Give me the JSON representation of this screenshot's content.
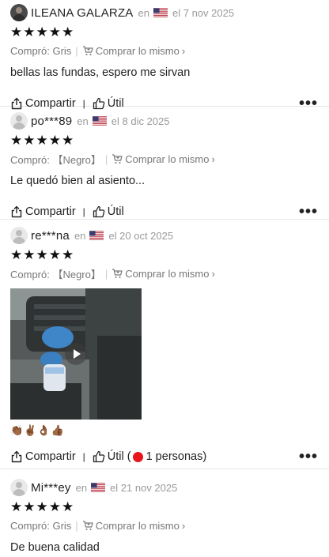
{
  "reviews": [
    {
      "name": "ILEANA GALARZA",
      "en": "en",
      "date": "el 7 nov 2025",
      "stars": "★★★★★",
      "variant": "Compró: Gris",
      "buy_same": "Comprar lo mismo",
      "text": "bellas las fundas, espero me sirvan",
      "share": "Compartir",
      "helpful": "Útil",
      "more": "•••"
    },
    {
      "name": "po***89",
      "en": "en",
      "date": "el 8 dic 2025",
      "stars": "★★★★★",
      "variant": "Compró: 【Negro】",
      "buy_same": "Comprar lo mismo",
      "text": "Le quedó bien al asiento...",
      "share": "Compartir",
      "helpful": "Útil",
      "more": "•••"
    },
    {
      "name": "re***na",
      "en": "en",
      "date": "el 20 oct 2025",
      "stars": "★★★★★",
      "variant": "Compró: 【Negro】",
      "buy_same": "Comprar lo mismo",
      "emojis": "👏🏾✌🏾👌🏾👍🏾",
      "share": "Compartir",
      "helpful": "Útil (",
      "helpful_count": "1 personas)",
      "more": "•••"
    },
    {
      "name": "Mi***ey",
      "en": "en",
      "date": "el 21 nov 2025",
      "stars": "★★★★★",
      "variant": "Compró: Gris",
      "buy_same": "Comprar lo mismo",
      "text": "De buena calidad"
    }
  ],
  "colors": {
    "accent_red": "#e8151d",
    "muted": "#9a9a9a"
  },
  "icons": [
    "avatar-placeholder",
    "us-flag-icon",
    "cart-icon",
    "chevron-right-icon",
    "share-icon",
    "thumbs-up-icon",
    "play-icon",
    "more-icon"
  ]
}
